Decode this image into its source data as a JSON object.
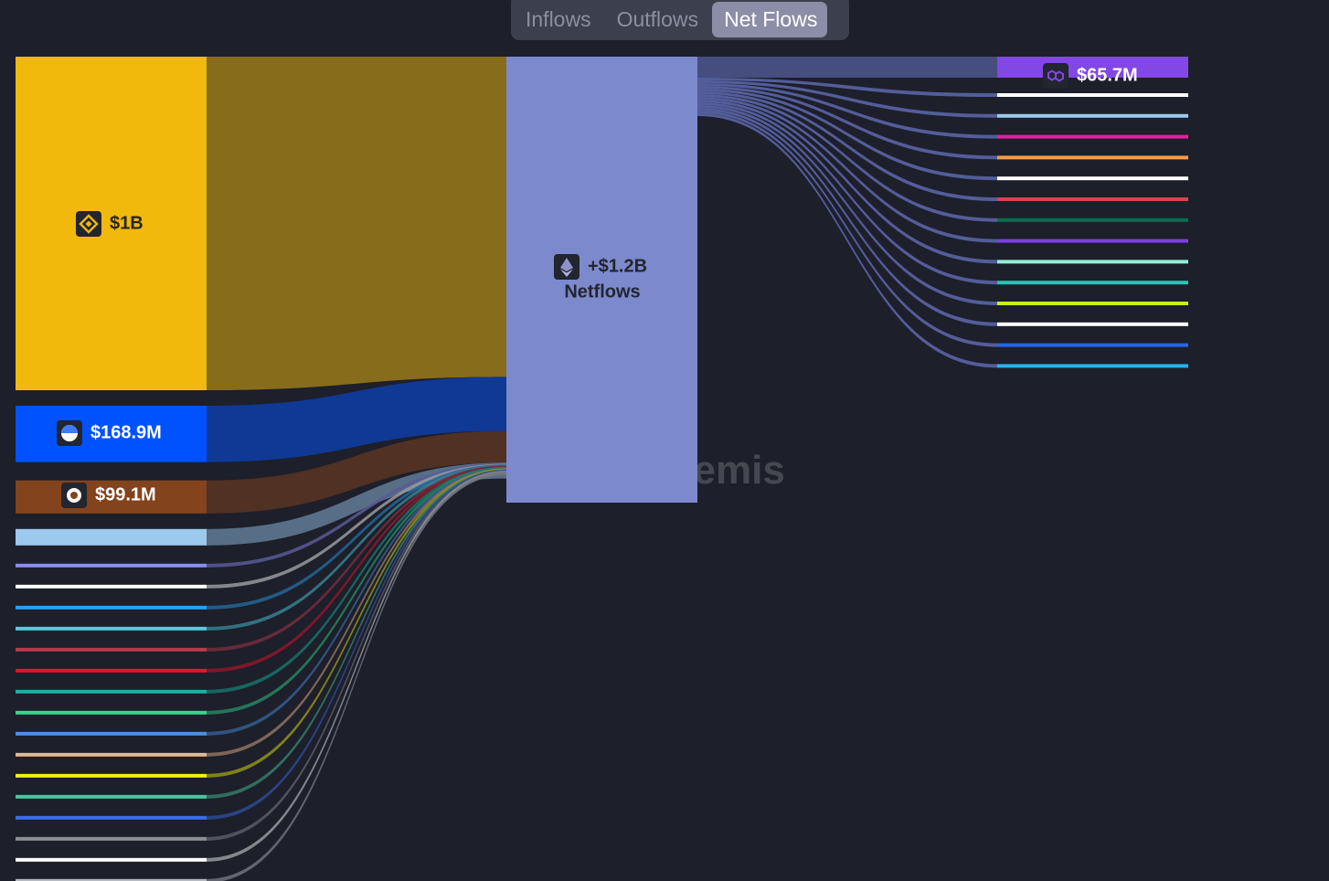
{
  "tabs": [
    {
      "label": "Inflows",
      "active": false
    },
    {
      "label": "Outflows",
      "active": false
    },
    {
      "label": "Net Flows",
      "active": true
    }
  ],
  "watermark": "Artemis",
  "chart_data": {
    "type": "sankey",
    "center": {
      "value_label": "+$1.2B",
      "label": "Netflows",
      "icon": "ethereum-icon",
      "color": "#7c89cd"
    },
    "inflows": [
      {
        "value_label": "$1B",
        "value": 1000,
        "color": "#f0b90b",
        "icon": "binance-icon"
      },
      {
        "value_label": "$168.9M",
        "value": 168.9,
        "color": "#0052ff",
        "icon": "base-icon"
      },
      {
        "value_label": "$99.1M",
        "value": 99.1,
        "color": "#83431d",
        "icon": "mantle-icon"
      },
      {
        "value_label": "",
        "value": 55,
        "color": "#9cc9ee"
      },
      {
        "value_label": "",
        "value": 8,
        "color": "#8a8cf0"
      },
      {
        "value_label": "",
        "value": 8,
        "color": "#ffffff"
      },
      {
        "value_label": "",
        "value": 8,
        "color": "#28a0f0"
      },
      {
        "value_label": "",
        "value": 8,
        "color": "#4dd0e1"
      },
      {
        "value_label": "",
        "value": 8,
        "color": "#b83a4b"
      },
      {
        "value_label": "",
        "value": 8,
        "color": "#e8132d"
      },
      {
        "value_label": "",
        "value": 8,
        "color": "#13b5a0"
      },
      {
        "value_label": "",
        "value": 8,
        "color": "#2fd98e"
      },
      {
        "value_label": "",
        "value": 8,
        "color": "#4a90e2"
      },
      {
        "value_label": "",
        "value": 8,
        "color": "#e8b98b"
      },
      {
        "value_label": "",
        "value": 8,
        "color": "#f2f20e"
      },
      {
        "value_label": "",
        "value": 8,
        "color": "#4bc69a"
      },
      {
        "value_label": "",
        "value": 8,
        "color": "#3a6ee8"
      },
      {
        "value_label": "",
        "value": 8,
        "color": "#8c8f96"
      },
      {
        "value_label": "",
        "value": 8,
        "color": "#ffffff"
      },
      {
        "value_label": "",
        "value": 8,
        "color": "#b4b8c0"
      }
    ],
    "outflows": [
      {
        "value_label": "$65.7M",
        "value": 65.7,
        "color": "#8247e5",
        "icon": "polygon-icon"
      },
      {
        "value_label": "",
        "value": 6,
        "color": "#ffffff"
      },
      {
        "value_label": "",
        "value": 6,
        "color": "#9cc9ee"
      },
      {
        "value_label": "",
        "value": 6,
        "color": "#e91e9c"
      },
      {
        "value_label": "",
        "value": 6,
        "color": "#f79a4b"
      },
      {
        "value_label": "",
        "value": 6,
        "color": "#ffffff"
      },
      {
        "value_label": "",
        "value": 6,
        "color": "#d9434b"
      },
      {
        "value_label": "",
        "value": 6,
        "color": "#0a6e4f"
      },
      {
        "value_label": "",
        "value": 6,
        "color": "#7b3fe4"
      },
      {
        "value_label": "",
        "value": 6,
        "color": "#8ef0d8"
      },
      {
        "value_label": "",
        "value": 6,
        "color": "#1ec9b4"
      },
      {
        "value_label": "",
        "value": 6,
        "color": "#c8ef1c"
      },
      {
        "value_label": "",
        "value": 6,
        "color": "#ffffff"
      },
      {
        "value_label": "",
        "value": 6,
        "color": "#2563eb"
      },
      {
        "value_label": "",
        "value": 6,
        "color": "#22b5f0"
      }
    ]
  }
}
